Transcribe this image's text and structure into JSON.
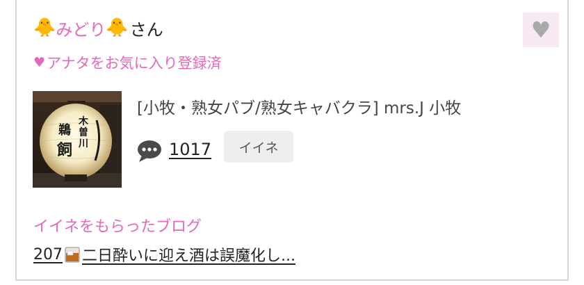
{
  "user": {
    "name": "みどり",
    "honorific": "さん",
    "name_emoji": "chick-emoji"
  },
  "favorite": {
    "button_icon": "heart-icon",
    "status_text": "アナタをお気に入り登録済"
  },
  "shop": {
    "name": "[小牧・熟女パブ/熟女キャバクラ]  mrs.J 小牧",
    "thumbnail": "lantern-photo",
    "lantern_text": "木曽川 鵜飼"
  },
  "stats": {
    "comment_icon": "speech-bubble-icon",
    "comment_count": "1017",
    "iine_label": "イイネ"
  },
  "blog": {
    "heading": "イイネをもらったブログ",
    "number": "207",
    "icon": "whisky-glass-icon",
    "title": "二日酔いに迎え酒は誤魔化し..."
  },
  "colors": {
    "accent_pink": "#e668b9",
    "fav_bg": "#f7e9f1",
    "button_bg": "#eeeeee",
    "border": "#d6d6d6"
  }
}
